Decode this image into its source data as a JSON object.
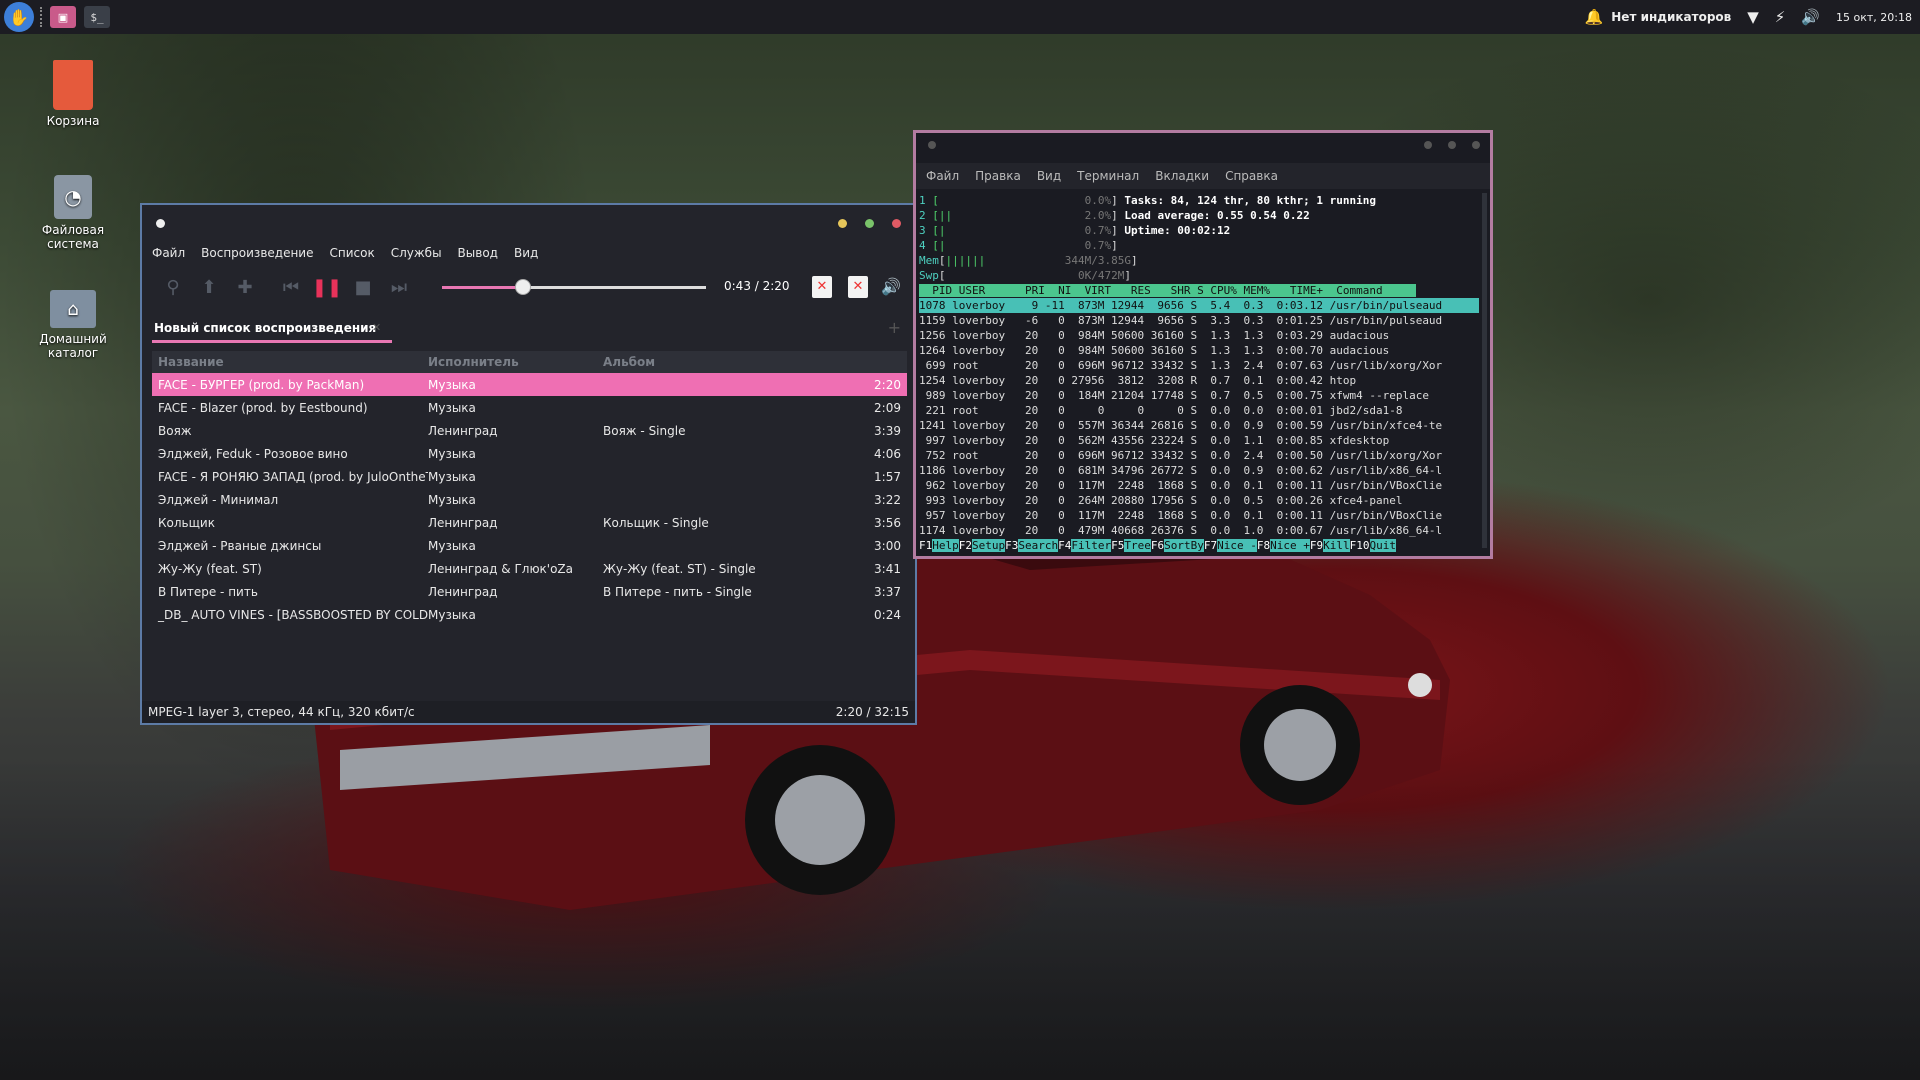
{
  "panel": {
    "indicator_label": "Нет индикаторов",
    "clock": "15 окт, 20:18"
  },
  "desktop": {
    "icons": [
      {
        "label": "Корзина",
        "icon": "trash-icon"
      },
      {
        "label": "Файловая система",
        "icon": "drive-icon"
      },
      {
        "label": "Домашний каталог",
        "icon": "home-folder-icon"
      }
    ]
  },
  "audacious": {
    "menu": [
      "Файл",
      "Воспроизведение",
      "Список",
      "Службы",
      "Вывод",
      "Вид"
    ],
    "time": "0:43 / 2:20",
    "progress": 0.307,
    "tab_title": "Новый список воспроизведения",
    "columns": [
      "Название",
      "Исполнитель",
      "Альбом"
    ],
    "rows": [
      {
        "title": "FACE - БУРГЕР (prod. by PackMan)",
        "artist": "Музыка",
        "album": "",
        "len": "2:20"
      },
      {
        "title": "FACE - Blazer (prod. by Eestbound)",
        "artist": "Музыка",
        "album": "",
        "len": "2:09"
      },
      {
        "title": "Вояж",
        "artist": "Ленинград",
        "album": "Вояж - Single",
        "len": "3:39"
      },
      {
        "title": "Элджей, Feduk - Розовое вино",
        "artist": "Музыка",
        "album": "",
        "len": "4:06"
      },
      {
        "title": "FACE - Я РОНЯЮ ЗАПАД (prod. by JuloOntheT…",
        "artist": "Музыка",
        "album": "",
        "len": "1:57"
      },
      {
        "title": "Элджей - Минимал",
        "artist": "Музыка",
        "album": "",
        "len": "3:22"
      },
      {
        "title": "Кольщик",
        "artist": "Ленинград",
        "album": "Кольщик - Single",
        "len": "3:56"
      },
      {
        "title": "Элджей - Рваные джинсы",
        "artist": "Музыка",
        "album": "",
        "len": "3:00"
      },
      {
        "title": "Жу-Жу (feat. ST)",
        "artist": "Ленинград & Глюк'oZa",
        "album": "Жу-Жу (feat. ST) - Single",
        "len": "3:41"
      },
      {
        "title": "В Питере - пить",
        "artist": "Ленинград",
        "album": "В Питере - пить - Single",
        "len": "3:37"
      },
      {
        "title": "_DB_ AUTO VINES - [BASSBOOSTED BY COLD …",
        "artist": "Музыка",
        "album": "",
        "len": "0:24"
      }
    ],
    "status_left": "MPEG-1 layer 3, стерео, 44 кГц, 320 кбит/с",
    "status_right": "2:20 / 32:15"
  },
  "terminal": {
    "menu": [
      "Файл",
      "Правка",
      "Вид",
      "Терминал",
      "Вкладки",
      "Справка"
    ],
    "cpu": [
      "0.0%",
      "2.0%",
      "0.7%",
      "0.7%"
    ],
    "mem": "344M/3.85G",
    "swp": "0K/472M",
    "tasks": "Tasks: 84, 124 thr, 80 kthr; 1 running",
    "load": "Load average: 0.55 0.54 0.22",
    "uptime": "Uptime: 00:02:12",
    "header": "  PID USER      PRI  NI  VIRT   RES   SHR S CPU% MEM%   TIME+  Command",
    "procs": [
      "1078 loverboy    9 -11  873M 12944  9656 S  5.4  0.3  0:03.12 /usr/bin/pulseaud",
      "1159 loverboy   -6   0  873M 12944  9656 S  3.3  0.3  0:01.25 /usr/bin/pulseaud",
      "1256 loverboy   20   0  984M 50600 36160 S  1.3  1.3  0:03.29 audacious",
      "1264 loverboy   20   0  984M 50600 36160 S  1.3  1.3  0:00.70 audacious",
      " 699 root       20   0  696M 96712 33432 S  1.3  2.4  0:07.63 /usr/lib/xorg/Xor",
      "1254 loverboy   20   0 27956  3812  3208 R  0.7  0.1  0:00.42 htop",
      " 989 loverboy   20   0  184M 21204 17748 S  0.7  0.5  0:00.75 xfwm4 --replace",
      " 221 root       20   0     0     0     0 S  0.0  0.0  0:00.01 jbd2/sda1-8",
      "1241 loverboy   20   0  557M 36344 26816 S  0.0  0.9  0:00.59 /usr/bin/xfce4-te",
      " 997 loverboy   20   0  562M 43556 23224 S  0.0  1.1  0:00.85 xfdesktop",
      " 752 root       20   0  696M 96712 33432 S  0.0  2.4  0:00.50 /usr/lib/xorg/Xor",
      "1186 loverboy   20   0  681M 34796 26772 S  0.0  0.9  0:00.62 /usr/lib/x86_64-l",
      " 962 loverboy   20   0  117M  2248  1868 S  0.0  0.1  0:00.11 /usr/bin/VBoxClie",
      " 993 loverboy   20   0  264M 20880 17956 S  0.0  0.5  0:00.26 xfce4-panel",
      " 957 loverboy   20   0  117M  2248  1868 S  0.0  0.1  0:00.11 /usr/bin/VBoxClie",
      "1174 loverboy   20   0  479M 40668 26376 S  0.0  1.0  0:00.67 /usr/lib/x86_64-l"
    ],
    "fkeys": [
      [
        "F1",
        "Help"
      ],
      [
        "F2",
        "Setup"
      ],
      [
        "F3",
        "Search"
      ],
      [
        "F4",
        "Filter"
      ],
      [
        "F5",
        "Tree"
      ],
      [
        "F6",
        "SortBy"
      ],
      [
        "F7",
        "Nice -"
      ],
      [
        "F8",
        "Nice +"
      ],
      [
        "F9",
        "Kill"
      ],
      [
        "F10",
        "Quit"
      ]
    ]
  },
  "colors": {
    "accent": "#ef6fb3",
    "audacious_border": "#5d7ba6",
    "terminal_border": "#b37ca1",
    "htop_green": "#4bc68e"
  }
}
